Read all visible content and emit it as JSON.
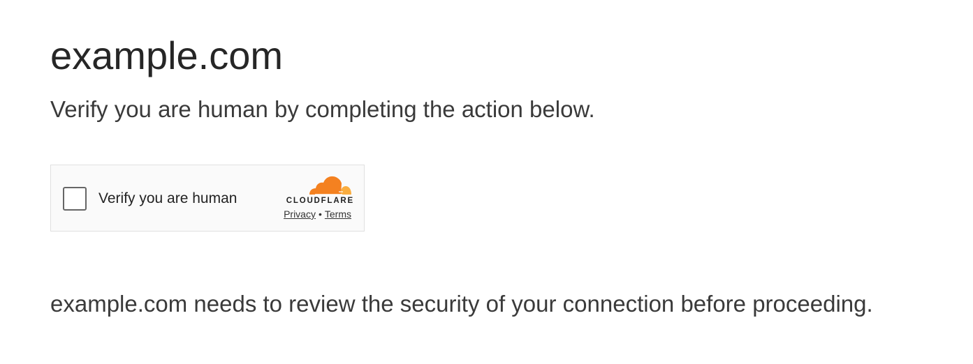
{
  "page": {
    "title": "example.com",
    "subtitle": "Verify you are human by completing the action below.",
    "footer": "example.com needs to review the security of your connection before proceeding."
  },
  "widget": {
    "checkbox_label": "Verify you are human",
    "checked": false,
    "brand_name": "CLOUDFLARE",
    "brand_icon": "cloudflare-cloud-logo",
    "privacy_link": "Privacy",
    "separator": "•",
    "terms_link": "Terms"
  },
  "colors": {
    "brand_orange": "#f48120",
    "brand_orange_light": "#faad3f",
    "text": "#313131",
    "widget_bg": "#fafafa",
    "widget_border": "#e0e0e0"
  }
}
